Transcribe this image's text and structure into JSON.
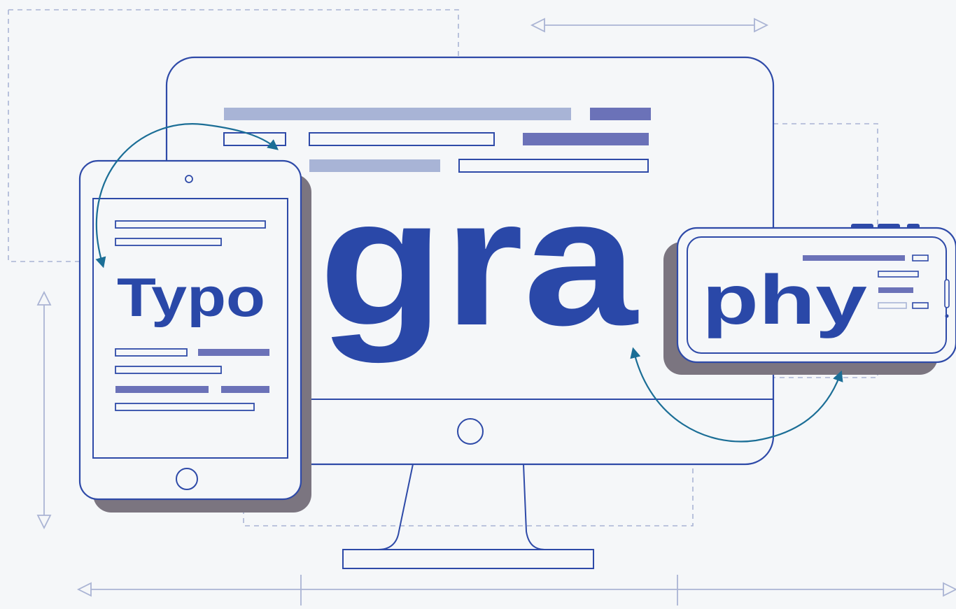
{
  "words": {
    "tablet": "Typo",
    "desktop": "gra",
    "phone": "phy"
  },
  "colors": {
    "background": "#f5f7f9",
    "outline": "#2e4aa8",
    "headline": "#2a48a8",
    "bar_dark": "#6b72b8",
    "bar_light": "#a8b4d6",
    "guide": "#aab4d4",
    "arrow": "#1b6e96",
    "shadow": "#7b7580"
  },
  "icons": [
    "desktop-monitor-icon",
    "tablet-device-icon",
    "smartphone-device-icon",
    "curved-transfer-arrow-icon",
    "dimension-arrow-icon"
  ]
}
